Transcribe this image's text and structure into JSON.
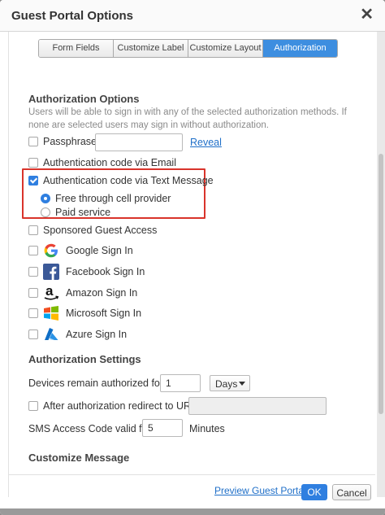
{
  "dialog": {
    "title": "Guest Portal Options"
  },
  "tabs": [
    {
      "label": "Form Fields",
      "active": false
    },
    {
      "label": "Customize Label",
      "active": false
    },
    {
      "label": "Customize Layout",
      "active": false
    },
    {
      "label": "Authorization",
      "active": true
    }
  ],
  "authorization_options": {
    "title": "Authorization Options",
    "help": "Users will be able to sign in with any of the selected authorization methods. If none are selected users may sign in without authorization.",
    "passphrase": {
      "label": "Passphrase",
      "checked": false,
      "value": "",
      "reveal_label": "Reveal"
    },
    "email_code": {
      "label": "Authentication code via Email",
      "checked": false
    },
    "sms_code": {
      "label": "Authentication code via Text Message",
      "checked": true
    },
    "sms_modes": [
      {
        "label": "Free through cell provider",
        "selected": true
      },
      {
        "label": "Paid service",
        "selected": false
      }
    ],
    "sponsored": {
      "label": "Sponsored Guest Access",
      "checked": false
    },
    "social": [
      {
        "label": "Google Sign In",
        "icon": "google-icon",
        "checked": false
      },
      {
        "label": "Facebook Sign In",
        "icon": "facebook-icon",
        "checked": false
      },
      {
        "label": "Amazon Sign In",
        "icon": "amazon-icon",
        "checked": false
      },
      {
        "label": "Microsoft Sign In",
        "icon": "microsoft-icon",
        "checked": false
      },
      {
        "label": "Azure Sign In",
        "icon": "azure-icon",
        "checked": false
      }
    ]
  },
  "authorization_settings": {
    "title": "Authorization Settings",
    "devices_label": "Devices remain authorized for",
    "devices_value": "1",
    "devices_unit": "Days",
    "redirect_label": "After authorization redirect to URL",
    "redirect_checked": false,
    "redirect_value": "",
    "sms_valid_label": "SMS Access Code valid for",
    "sms_valid_value": "5",
    "sms_valid_unit": "Minutes"
  },
  "customize_message": {
    "title": "Customize Message"
  },
  "footer": {
    "preview_label": "Preview Guest Portal",
    "ok_label": "OK",
    "cancel_label": "Cancel"
  },
  "colors": {
    "accent": "#2f7fe0",
    "highlight": "#d9342b"
  }
}
